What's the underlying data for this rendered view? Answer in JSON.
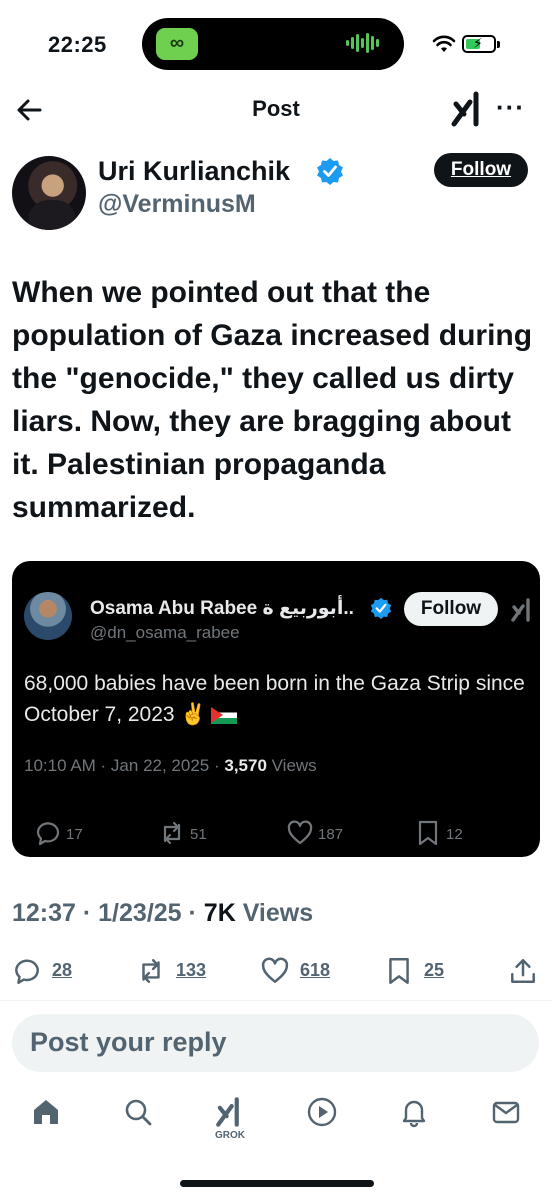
{
  "status_bar": {
    "time": "22:25",
    "battery_color": "#34c759"
  },
  "header": {
    "title": "Post"
  },
  "author": {
    "name": "Uri Kurlianchik",
    "handle": "@VerminusM",
    "follow_label": "Follow"
  },
  "post": {
    "text": "When we pointed out that the population of Gaza increased during the \"genocide,\" they called us dirty liars. Now, they are bragging about it. Palestinian propaganda summarized.",
    "timestamp": "12:37 · 1/23/25 · ",
    "views_count": "7K",
    "views_label": " Views"
  },
  "quoted": {
    "name": "Osama Abu Rabee أبوربيع ة..",
    "handle": "@dn_osama_rabee",
    "follow_label": "Follow",
    "text": "68,000 babies have been born in the Gaza Strip since October 7, 2023 ✌️",
    "meta_prefix": "10:10 AM · Jan 22, 2025 · ",
    "views_count": "3,570",
    "views_label": " Views",
    "stats": {
      "replies": "17",
      "reposts": "51",
      "likes": "187",
      "bookmarks": "12"
    }
  },
  "actions": {
    "replies": "28",
    "reposts": "133",
    "likes": "618",
    "bookmarks": "25"
  },
  "reply_box": {
    "placeholder": "Post your reply"
  },
  "tabbar": {
    "grok_label": "GROK"
  },
  "colors": {
    "text": "#0f1419",
    "muted": "#536471",
    "verified": "#1d9bf0"
  }
}
